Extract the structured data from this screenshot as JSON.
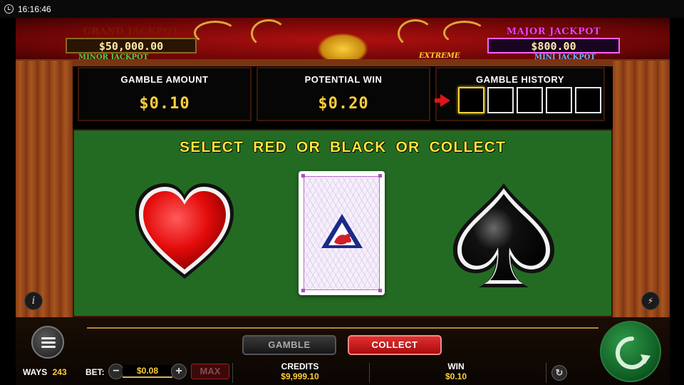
{
  "status_bar": {
    "time": "16:16:46"
  },
  "jackpots": {
    "grand_label": "GRAND JACKPOT",
    "grand_value": "$50,000.00",
    "minor_label": "MINOR JACKPOT",
    "major_label": "MAJOR JACKPOT",
    "major_value": "$800.00",
    "mini_label": "MINI JACKPOT",
    "extreme_label": "EXTREME"
  },
  "panels": {
    "gamble_amount_label": "GAMBLE AMOUNT",
    "gamble_amount_value": "$0.10",
    "potential_win_label": "POTENTIAL WIN",
    "potential_win_value": "$0.20",
    "gamble_history_label": "GAMBLE HISTORY",
    "history_slots": 5
  },
  "table": {
    "prompt": "SELECT RED OR BLACK OR COLLECT",
    "red_choice": "heart",
    "black_choice": "spade"
  },
  "controls": {
    "gamble_label": "GAMBLE",
    "collect_label": "COLLECT",
    "ways_label": "WAYS",
    "ways_value": "243",
    "bet_label": "BET:",
    "bet_value": "$0.08",
    "max_label": "MAX",
    "credits_label": "CREDITS",
    "credits_value": "$9,999.10",
    "win_label": "WIN",
    "win_value": "$0.10"
  },
  "colors": {
    "felt": "#236b23",
    "accent_gold": "#ffcf3a",
    "collect_red": "#d01e1e",
    "spin_green": "#1f7a36"
  }
}
